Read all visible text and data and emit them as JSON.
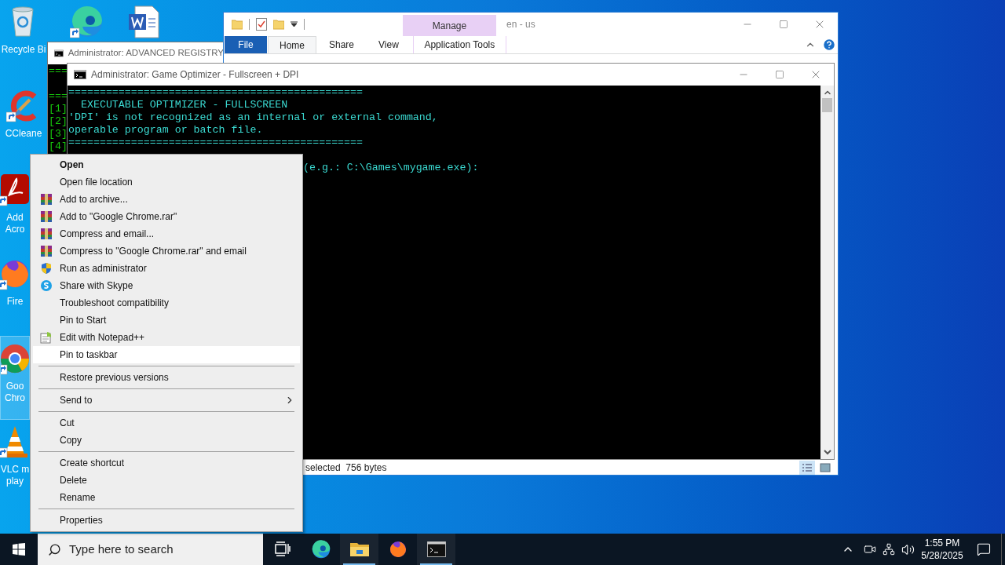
{
  "desktop": {
    "icons": [
      {
        "kind": "recycle",
        "label_lines": [
          "Recycle Bi"
        ],
        "selected": false
      },
      {
        "kind": "ccleaner",
        "label_lines": [
          "CCleane"
        ],
        "selected": false
      },
      {
        "kind": "acrobat",
        "label_lines": [
          "Add",
          "Acro"
        ],
        "selected": false
      },
      {
        "kind": "firefox",
        "label_lines": [
          "Fire"
        ],
        "selected": false
      },
      {
        "kind": "chrome",
        "label_lines": [
          "Goo",
          "Chro"
        ],
        "selected": true
      },
      {
        "kind": "vlc",
        "label_lines": [
          "VLC m",
          "play"
        ],
        "selected": false
      }
    ],
    "top_icons": [
      {
        "kind": "edge"
      },
      {
        "kind": "word"
      }
    ]
  },
  "registry_window": {
    "title": "Administrator:  ADVANCED REGISTRY",
    "lines": [
      "===",
      "===",
      "[1]",
      "[2]",
      "[3]",
      "[4]"
    ]
  },
  "explorer": {
    "title": "en - us",
    "context_tab": "Manage",
    "tabs": [
      {
        "label": "File",
        "kind": "file",
        "selected": false
      },
      {
        "label": "Home",
        "kind": "tab",
        "selected": true
      },
      {
        "label": "Share",
        "kind": "tab",
        "selected": false
      },
      {
        "label": "View",
        "kind": "tab",
        "selected": false
      },
      {
        "label": "Application Tools",
        "kind": "context",
        "selected": false
      }
    ],
    "status": "selected  756 bytes"
  },
  "game_window": {
    "title": "Administrator:  Game Optimizer - Fullscreen + DPI",
    "lines": [
      "===============================================",
      "  EXECUTABLE OPTIMIZER - FULLSCREEN",
      "'DPI' is not recognized as an internal or external command,",
      "operable program or batch file.",
      "==============================================="
    ],
    "prompt_visible": "(e.g.: C:\\Games\\mygame.exe):"
  },
  "context_menu": {
    "groups": [
      [
        {
          "label": "Open",
          "kind": "plain",
          "default": true,
          "submenu": false,
          "selected": false
        },
        {
          "label": "Open file location",
          "kind": "plain",
          "default": false,
          "submenu": false,
          "selected": false
        },
        {
          "label": "Add to archive...",
          "kind": "archive",
          "default": false,
          "submenu": false,
          "selected": false
        },
        {
          "label": "Add to \"Google Chrome.rar\"",
          "kind": "archive",
          "default": false,
          "submenu": false,
          "selected": false
        },
        {
          "label": "Compress and email...",
          "kind": "archive",
          "default": false,
          "submenu": false,
          "selected": false
        },
        {
          "label": "Compress to \"Google Chrome.rar\" and email",
          "kind": "archive",
          "default": false,
          "submenu": false,
          "selected": false
        },
        {
          "label": "Run as administrator",
          "kind": "shield",
          "default": false,
          "submenu": false,
          "selected": false
        },
        {
          "label": "Share with Skype",
          "kind": "skype",
          "default": false,
          "submenu": false,
          "selected": false
        },
        {
          "label": "Troubleshoot compatibility",
          "kind": "plain",
          "default": false,
          "submenu": false,
          "selected": false
        },
        {
          "label": "Pin to Start",
          "kind": "plain",
          "default": false,
          "submenu": false,
          "selected": false
        },
        {
          "label": "Edit with Notepad++",
          "kind": "notepad",
          "default": false,
          "submenu": false,
          "selected": false
        },
        {
          "label": "Pin to taskbar",
          "kind": "plain",
          "default": false,
          "submenu": false,
          "selected": true
        }
      ],
      [
        {
          "label": "Restore previous versions",
          "kind": "plain",
          "default": false,
          "submenu": false,
          "selected": false
        }
      ],
      [
        {
          "label": "Send to",
          "kind": "plain",
          "default": false,
          "submenu": true,
          "selected": false
        }
      ],
      [
        {
          "label": "Cut",
          "kind": "plain",
          "default": false,
          "submenu": false,
          "selected": false
        },
        {
          "label": "Copy",
          "kind": "plain",
          "default": false,
          "submenu": false,
          "selected": false
        }
      ],
      [
        {
          "label": "Create shortcut",
          "kind": "plain",
          "default": false,
          "submenu": false,
          "selected": false
        },
        {
          "label": "Delete",
          "kind": "plain",
          "default": false,
          "submenu": false,
          "selected": false
        },
        {
          "label": "Rename",
          "kind": "plain",
          "default": false,
          "submenu": false,
          "selected": false
        }
      ],
      [
        {
          "label": "Properties",
          "kind": "plain",
          "default": false,
          "submenu": false,
          "selected": false
        }
      ]
    ]
  },
  "taskbar": {
    "search": {
      "placeholder": "Type here to search"
    },
    "apps": [
      {
        "kind": "taskview",
        "running": false
      },
      {
        "kind": "edge",
        "running": false
      },
      {
        "kind": "explorer",
        "running": true
      },
      {
        "kind": "firefox",
        "running": false
      },
      {
        "kind": "console",
        "running": true
      }
    ],
    "clock": {
      "time": "1:55 PM",
      "date": "5/28/2025"
    }
  }
}
